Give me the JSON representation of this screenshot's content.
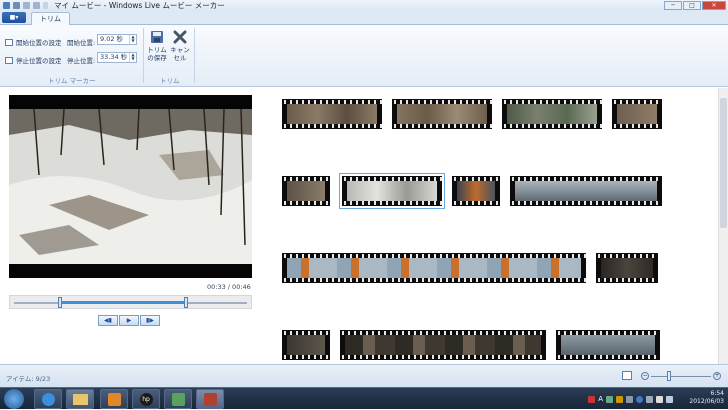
{
  "window": {
    "title": "マイ ムービー - Windows Live ムービー メーカー",
    "minimize": "─",
    "maximize": "□",
    "close": "✕"
  },
  "menu": {
    "file_button": "■▾"
  },
  "tabs": [
    {
      "label": "トリム",
      "active": true
    }
  ],
  "ribbon": {
    "set_start_label": "開始位置の設定",
    "set_end_label": "停止位置の設定",
    "start_pos_label": "開始位置:",
    "start_pos_value": "9.02 秒",
    "end_pos_label": "停止位置:",
    "end_pos_value": "33.34 秒",
    "trim_markers_group": "トリム マーカー",
    "save_trim_label_1": "トリム",
    "save_trim_label_2": "の保存",
    "cancel_label_1": "キャン",
    "cancel_label_2": "セル",
    "trim_group": "トリム"
  },
  "preview": {
    "timecode": "00:33 / 00:46",
    "trim_start_fraction": 0.196,
    "trim_end_fraction": 0.737,
    "prev_frame": "◀▮",
    "play": "▶",
    "next_frame": "▮▶"
  },
  "status": {
    "items_text": "アイテム: 9/23",
    "zoom_level": 0.3
  },
  "taskbar": {
    "clock_time": "6:54",
    "clock_date": "2012/06/03",
    "lang_indicator": "A",
    "hp_label": "hp"
  },
  "colors": {
    "accent": "#3d8fd8",
    "ribbon_bg": "#e4edf7",
    "taskbar_bg": "#182638"
  }
}
